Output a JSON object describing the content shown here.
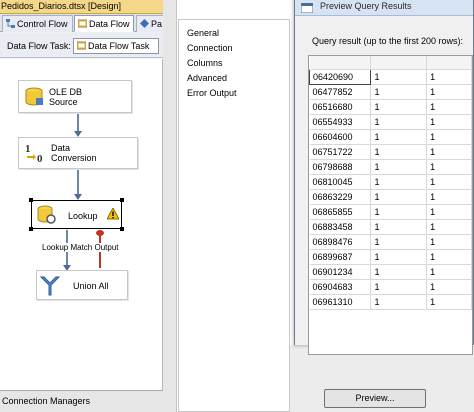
{
  "designer": {
    "doc_title": "Pedidos_Diarios.dtsx [Design]",
    "tabs": [
      {
        "label": "Control Flow"
      },
      {
        "label": "Data Flow"
      },
      {
        "label": "Pa"
      }
    ],
    "task_label": "Data Flow Task:",
    "task_value": "Data Flow Task",
    "components": [
      {
        "label": "OLE DB\nSource",
        "icon": "database-icon"
      },
      {
        "label": "Data\nConversion",
        "icon": "data-conversion-icon"
      },
      {
        "label": "Lookup",
        "icon": "lookup-icon",
        "warning": "warning-icon"
      },
      {
        "label": "Union All",
        "icon": "union-icon"
      }
    ],
    "lookup_output_label": "Lookup Match Output",
    "connection_managers_tab": "Connection Managers"
  },
  "properties_nav": {
    "items": [
      "General",
      "Connection",
      "Columns",
      "Advanced",
      "Error Output"
    ]
  },
  "dialog": {
    "title": "Preview Query Results",
    "query_label": "Query result (up to the first 200 rows):",
    "rows": [
      [
        "06420690",
        "1",
        "1"
      ],
      [
        "06477852",
        "1",
        "1"
      ],
      [
        "06516680",
        "1",
        "1"
      ],
      [
        "06554933",
        "1",
        "1"
      ],
      [
        "06604600",
        "1",
        "1"
      ],
      [
        "06751722",
        "1",
        "1"
      ],
      [
        "06798688",
        "1",
        "1"
      ],
      [
        "06810045",
        "1",
        "1"
      ],
      [
        "06863229",
        "1",
        "1"
      ],
      [
        "06865855",
        "1",
        "1"
      ],
      [
        "06883458",
        "1",
        "1"
      ],
      [
        "06898476",
        "1",
        "1"
      ],
      [
        "06899687",
        "1",
        "1"
      ],
      [
        "06901234",
        "1",
        "1"
      ],
      [
        "06904683",
        "1",
        "1"
      ],
      [
        "06961310",
        "1",
        "1"
      ]
    ]
  },
  "preview_button": "Preview...",
  "colors": {
    "arrow": "#4e6d96",
    "doc_tab": "#f5d78a",
    "warning": "#f2c200"
  }
}
